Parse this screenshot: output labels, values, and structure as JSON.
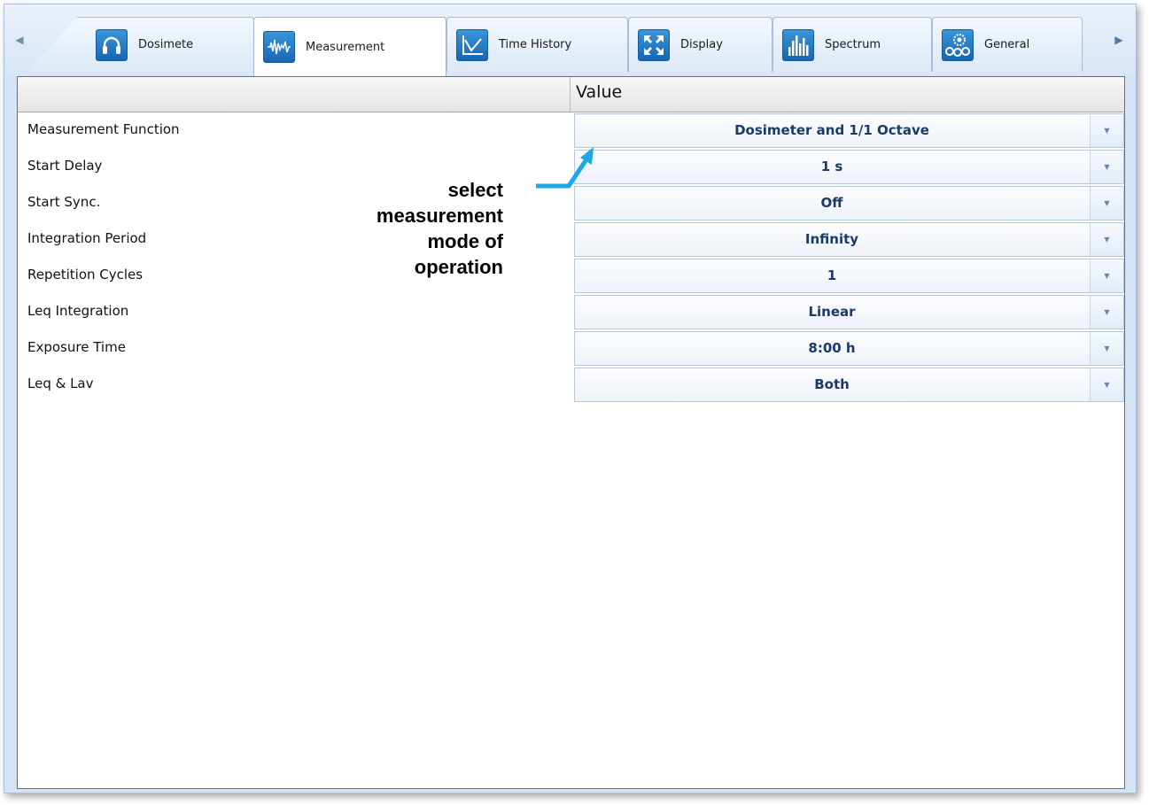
{
  "tabs": [
    {
      "label": "Dosimete",
      "icon": "headphones-icon"
    },
    {
      "label": "Measurement",
      "icon": "waveform-icon"
    },
    {
      "label": "Time History",
      "icon": "line-chart-icon"
    },
    {
      "label": "Display",
      "icon": "expand-arrows-icon"
    },
    {
      "label": "Spectrum",
      "icon": "spectrum-bars-icon"
    },
    {
      "label": "General",
      "icon": "gears-icon"
    }
  ],
  "active_tab": "Measurement",
  "grid": {
    "header_value": "Value",
    "rows": [
      {
        "name": "Measurement Function",
        "value": "Dosimeter and 1/1 Octave"
      },
      {
        "name": "Start Delay",
        "value": "1 s"
      },
      {
        "name": "Start Sync.",
        "value": "Off"
      },
      {
        "name": "Integration Period",
        "value": "Infinity"
      },
      {
        "name": "Repetition Cycles",
        "value": "1"
      },
      {
        "name": "Leq Integration",
        "value": "Linear"
      },
      {
        "name": "Exposure Time",
        "value": "8:00 h"
      },
      {
        "name": "Leq & Lav",
        "value": "Both"
      }
    ]
  },
  "callout": {
    "lines": [
      "select",
      "measurement",
      "mode of",
      "operation"
    ],
    "arrow_color": "#1ba8e6"
  },
  "colors": {
    "tab_icon_blue": "#1f78c8",
    "value_text": "#1b3a6b",
    "frame_bg": "#d5e4f4"
  }
}
